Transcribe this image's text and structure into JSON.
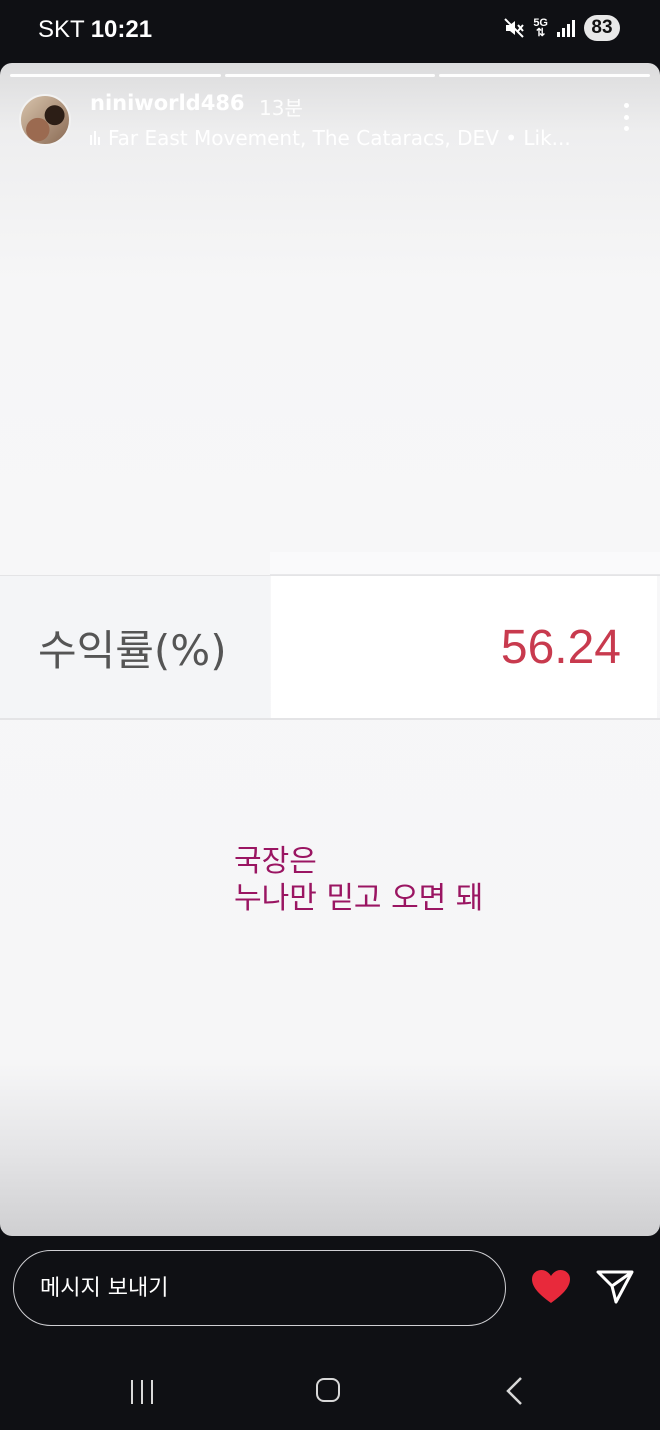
{
  "status_bar": {
    "carrier": "SKT",
    "time": "10:21",
    "network": "5G",
    "battery": "83"
  },
  "story": {
    "progress_segments": 3,
    "username": "niniworld486",
    "time_ago": "13분",
    "music": "Far East Movement, The Cataracs, DEV • Lik...",
    "table": {
      "label": "수익률(%)",
      "value": "56.24",
      "value_color": "#c83a4e"
    },
    "caption": "국장은\n누나만 믿고 오면 돼",
    "caption_color": "#9a1562"
  },
  "reply": {
    "placeholder": "메시지 보내기",
    "heart_color": "#e8293b"
  },
  "icons": [
    "mute-icon",
    "5g-icon",
    "signal-icon",
    "music-icon",
    "more-icon",
    "heart-icon",
    "send-icon",
    "recent-apps-icon",
    "home-icon",
    "back-icon"
  ]
}
